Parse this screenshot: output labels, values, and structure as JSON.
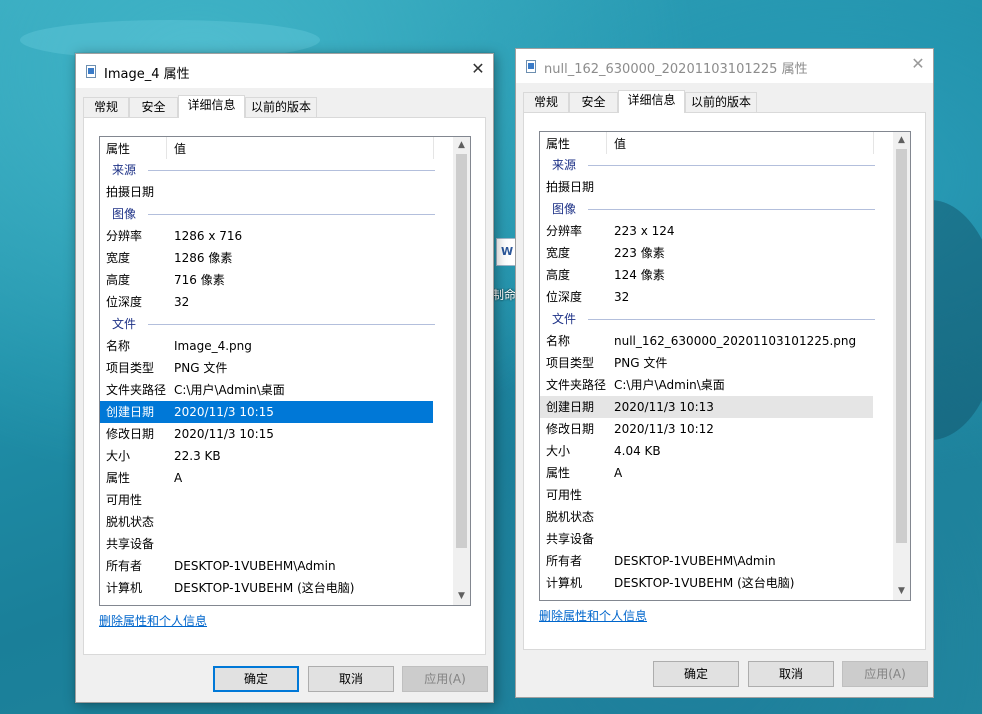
{
  "desktop": {
    "icon_label": "制命配置"
  },
  "left": {
    "title": "Image_4 属性",
    "tabs": [
      "常规",
      "安全",
      "详细信息",
      "以前的版本"
    ],
    "header": {
      "prop": "属性",
      "value": "值"
    },
    "groups": {
      "source": "来源",
      "image": "图像",
      "file": "文件"
    },
    "rows": [
      {
        "k": "拍摄日期",
        "v": ""
      },
      {
        "k": "分辨率",
        "v": "1286 x 716"
      },
      {
        "k": "宽度",
        "v": "1286 像素"
      },
      {
        "k": "高度",
        "v": "716 像素"
      },
      {
        "k": "位深度",
        "v": "32"
      },
      {
        "k": "名称",
        "v": "Image_4.png"
      },
      {
        "k": "项目类型",
        "v": "PNG 文件"
      },
      {
        "k": "文件夹路径",
        "v": "C:\\用户\\Admin\\桌面"
      },
      {
        "k": "创建日期",
        "v": "2020/11/3 10:15"
      },
      {
        "k": "修改日期",
        "v": "2020/11/3 10:15"
      },
      {
        "k": "大小",
        "v": "22.3 KB"
      },
      {
        "k": "属性",
        "v": "A"
      },
      {
        "k": "可用性",
        "v": ""
      },
      {
        "k": "脱机状态",
        "v": ""
      },
      {
        "k": "共享设备",
        "v": ""
      },
      {
        "k": "所有者",
        "v": "DESKTOP-1VUBEHM\\Admin"
      },
      {
        "k": "计算机",
        "v": "DESKTOP-1VUBEHM (这台电脑)"
      }
    ],
    "selected_row": "创建日期",
    "remove_link": "删除属性和个人信息",
    "buttons": {
      "ok": "确定",
      "cancel": "取消",
      "apply": "应用(A)"
    }
  },
  "right": {
    "title": "null_162_630000_20201103101225 属性",
    "tabs": [
      "常规",
      "安全",
      "详细信息",
      "以前的版本"
    ],
    "header": {
      "prop": "属性",
      "value": "值"
    },
    "groups": {
      "source": "来源",
      "image": "图像",
      "file": "文件"
    },
    "rows": [
      {
        "k": "拍摄日期",
        "v": ""
      },
      {
        "k": "分辨率",
        "v": "223 x 124"
      },
      {
        "k": "宽度",
        "v": "223 像素"
      },
      {
        "k": "高度",
        "v": "124 像素"
      },
      {
        "k": "位深度",
        "v": "32"
      },
      {
        "k": "名称",
        "v": "null_162_630000_20201103101225.png"
      },
      {
        "k": "项目类型",
        "v": "PNG 文件"
      },
      {
        "k": "文件夹路径",
        "v": "C:\\用户\\Admin\\桌面"
      },
      {
        "k": "创建日期",
        "v": "2020/11/3 10:13"
      },
      {
        "k": "修改日期",
        "v": "2020/11/3 10:12"
      },
      {
        "k": "大小",
        "v": "4.04 KB"
      },
      {
        "k": "属性",
        "v": "A"
      },
      {
        "k": "可用性",
        "v": ""
      },
      {
        "k": "脱机状态",
        "v": ""
      },
      {
        "k": "共享设备",
        "v": ""
      },
      {
        "k": "所有者",
        "v": "DESKTOP-1VUBEHM\\Admin"
      },
      {
        "k": "计算机",
        "v": "DESKTOP-1VUBEHM (这台电脑)"
      }
    ],
    "highlighted_row": "创建日期",
    "remove_link": "删除属性和个人信息",
    "buttons": {
      "ok": "确定",
      "cancel": "取消",
      "apply": "应用(A)"
    }
  },
  "colors": {
    "selection": "#0078d7",
    "group_text": "#1e3287",
    "link": "#0066cc"
  }
}
